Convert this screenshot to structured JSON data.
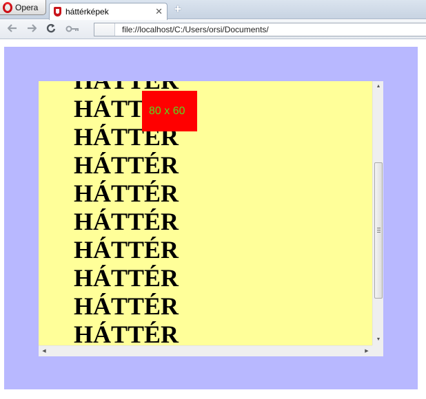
{
  "browser": {
    "menu_label": "Opera",
    "tab": {
      "title": "háttérképek",
      "close_glyph": "✕"
    },
    "new_tab_glyph": "+",
    "address": "file://localhost/C:/Users/orsi/Documents/",
    "nav_icons": [
      "back-arrow-icon",
      "forward-arrow-icon",
      "reload-icon",
      "key-icon"
    ]
  },
  "page": {
    "lines": [
      "HÁTTÉR",
      "HÁTTÉR",
      "HÁTTÉR",
      "HÁTTÉR",
      "HÁTTÉR",
      "HÁTTÉR",
      "HÁTTÉR",
      "HÁTTÉR",
      "HÁTTÉR",
      "HÁTTÉR"
    ],
    "box_label": "80 x 60",
    "colors": {
      "outer_background": "#b8b8ff",
      "scrollbox_background": "#ffff99",
      "box_background": "#ff0000",
      "box_label_color": "#55dd22"
    }
  }
}
